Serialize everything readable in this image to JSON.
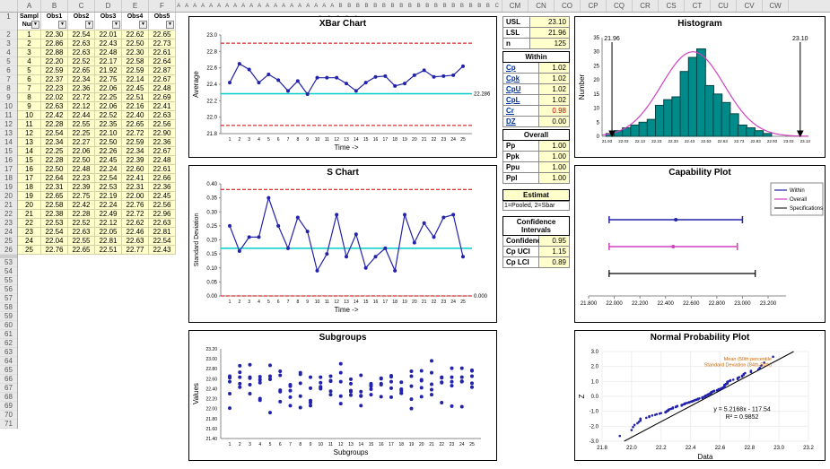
{
  "columns_left": [
    "A",
    "B",
    "C",
    "D",
    "E",
    "F"
  ],
  "columns_right": [
    "CM",
    "CN",
    "CO",
    "CP",
    "CQ",
    "CR",
    "CS",
    "CT",
    "CU",
    "CV",
    "CW"
  ],
  "row_numbers": [
    1,
    2,
    3,
    4,
    5,
    6,
    7,
    8,
    9,
    10,
    11,
    12,
    13,
    14,
    15,
    16,
    17,
    18,
    19,
    20,
    21,
    22,
    23,
    24,
    25,
    26,
    53,
    54,
    55,
    56,
    57,
    58,
    59,
    60,
    61,
    62,
    63,
    64,
    65,
    66,
    67,
    68,
    69,
    70,
    71
  ],
  "data_headers": [
    "Sampl\nNum",
    "Obs1",
    "Obs2",
    "Obs3",
    "Obs4",
    "Obs5"
  ],
  "data_rows": [
    [
      1,
      22.3,
      22.54,
      22.01,
      22.62,
      22.65
    ],
    [
      2,
      22.86,
      22.63,
      22.43,
      22.5,
      22.73
    ],
    [
      3,
      22.88,
      22.63,
      22.48,
      22.3,
      22.61
    ],
    [
      4,
      22.2,
      22.52,
      22.17,
      22.58,
      22.64
    ],
    [
      5,
      22.59,
      22.65,
      21.92,
      22.59,
      22.87
    ],
    [
      6,
      22.37,
      22.34,
      22.75,
      22.14,
      22.67
    ],
    [
      7,
      22.23,
      22.36,
      22.06,
      22.45,
      22.48
    ],
    [
      8,
      22.02,
      22.72,
      22.25,
      22.51,
      22.69
    ],
    [
      9,
      22.63,
      22.12,
      22.06,
      22.16,
      22.41
    ],
    [
      10,
      22.42,
      22.44,
      22.52,
      22.4,
      22.63
    ],
    [
      11,
      22.28,
      22.55,
      22.35,
      22.65,
      22.56
    ],
    [
      12,
      22.54,
      22.25,
      22.1,
      22.72,
      22.9
    ],
    [
      13,
      22.34,
      22.27,
      22.5,
      22.59,
      22.36
    ],
    [
      14,
      22.25,
      22.06,
      22.26,
      22.34,
      22.67
    ],
    [
      15,
      22.28,
      22.5,
      22.45,
      22.39,
      22.48
    ],
    [
      16,
      22.5,
      22.48,
      22.24,
      22.6,
      22.61
    ],
    [
      17,
      22.64,
      22.23,
      22.54,
      22.41,
      22.66
    ],
    [
      18,
      22.31,
      22.39,
      22.53,
      22.31,
      22.36
    ],
    [
      19,
      22.65,
      22.75,
      22.19,
      22.0,
      22.45
    ],
    [
      20,
      22.58,
      22.42,
      22.24,
      22.76,
      22.56
    ],
    [
      21,
      22.38,
      22.28,
      22.49,
      22.72,
      22.96
    ],
    [
      22,
      22.53,
      22.52,
      22.12,
      22.62,
      22.63
    ],
    [
      23,
      22.54,
      22.63,
      22.05,
      22.46,
      22.81
    ],
    [
      24,
      22.04,
      22.55,
      22.81,
      22.63,
      22.54
    ],
    [
      25,
      22.76,
      22.65,
      22.51,
      22.77,
      22.43
    ]
  ],
  "charts": {
    "xbar": {
      "title": "XBar Chart",
      "xlabel": "Time ->",
      "ylabel": "Average",
      "center": 22.286,
      "ucl": 22.9,
      "lcl": 21.9,
      "target": 22.2,
      "data": [
        22.42,
        22.65,
        22.58,
        22.42,
        22.52,
        22.45,
        22.32,
        22.44,
        22.28,
        22.48,
        22.48,
        22.48,
        22.41,
        22.32,
        22.42,
        22.49,
        22.5,
        22.38,
        22.41,
        22.51,
        22.57,
        22.49,
        22.5,
        22.51,
        22.62
      ]
    },
    "s": {
      "title": "S Chart",
      "xlabel": "Time ->",
      "ylabel": "Standard Deviation",
      "ucl": 0.38,
      "center": 0.17,
      "lcl": 0.0,
      "data": [
        0.25,
        0.16,
        0.21,
        0.21,
        0.35,
        0.25,
        0.17,
        0.28,
        0.23,
        0.09,
        0.15,
        0.29,
        0.14,
        0.22,
        0.1,
        0.14,
        0.17,
        0.09,
        0.29,
        0.19,
        0.26,
        0.21,
        0.28,
        0.29,
        0.14
      ]
    },
    "subgroups": {
      "title": "Subgroups",
      "xlabel": "Subgroups",
      "ylabel": "Values"
    },
    "histogram": {
      "title": "Histogram",
      "ylabel": "Number",
      "lsl_label": "21.96",
      "usl_label": "23.10",
      "bins": [
        21.95,
        22.0,
        22.05,
        22.1,
        22.15,
        22.2,
        22.25,
        22.3,
        22.35,
        22.4,
        22.45,
        22.5,
        22.55,
        22.6,
        22.65,
        22.7,
        22.75,
        22.8,
        22.85,
        22.9,
        22.95
      ],
      "counts": [
        1,
        2,
        3,
        4,
        5,
        6,
        11,
        13,
        14,
        23,
        28,
        31,
        18,
        15,
        12,
        8,
        4,
        3,
        2,
        1,
        0
      ]
    },
    "capability": {
      "title": "Capability Plot",
      "legend": [
        "Within",
        "Overall",
        "Specifications"
      ]
    },
    "normal": {
      "title": "Normal Probability Plot",
      "xlabel": "Data",
      "ylabel": "Z",
      "eq": "y = 5.2168x - 117.54",
      "r2": "R² = 0.9852",
      "anno1": "Mean (50th percentile",
      "anno2": "Standard Deviation (84th-50th)"
    }
  },
  "stats": {
    "usl": {
      "label": "USL",
      "value": "23.10"
    },
    "lsl": {
      "label": "LSL",
      "value": "21.96"
    },
    "n": {
      "label": "n",
      "value": "125"
    },
    "within_head": "Within",
    "within": [
      {
        "k": "Cp",
        "v": "1.02"
      },
      {
        "k": "Cpk",
        "v": "1.02"
      },
      {
        "k": "CpU",
        "v": "1.02"
      },
      {
        "k": "CpL",
        "v": "1.02"
      },
      {
        "k": "Cr",
        "v": "0.98",
        "red": true
      },
      {
        "k": "DZ",
        "v": "0.00"
      }
    ],
    "overall_head": "Overall",
    "overall": [
      {
        "k": "Pp",
        "v": "1.00"
      },
      {
        "k": "Ppk",
        "v": "1.00"
      },
      {
        "k": "Ppu",
        "v": "1.00"
      },
      {
        "k": "Ppl",
        "v": "1.00"
      }
    ],
    "estimat": "Estimat",
    "estimat_desc": "1=Pooled, 2=Sbar",
    "conf_head": "Confidence Intervals",
    "conf": [
      {
        "k": "Confidenc",
        "v": "0.95"
      },
      {
        "k": "Cp UCI",
        "v": "1.15"
      },
      {
        "k": "Cp LCI",
        "v": "0.89"
      }
    ]
  }
}
